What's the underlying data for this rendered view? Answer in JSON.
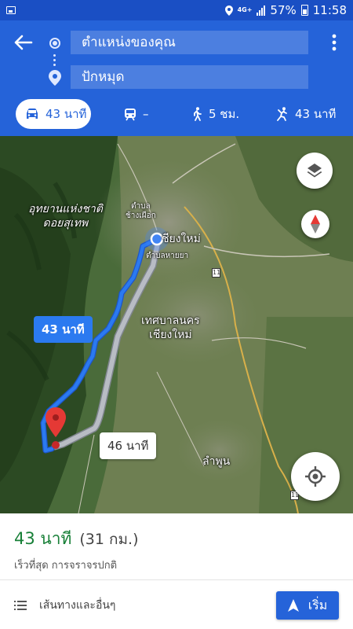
{
  "status_bar": {
    "network": "4G+",
    "battery": "57%",
    "time": "11:58"
  },
  "header": {
    "origin_text": "ตำแหน่งของคุณ",
    "destination_text": "ปักหมุด"
  },
  "modes": [
    {
      "mode": "drive",
      "icon": "car-icon",
      "label": "43 นาที",
      "selected": true
    },
    {
      "mode": "transit",
      "icon": "train-icon",
      "label": "–",
      "selected": false
    },
    {
      "mode": "walk",
      "icon": "walk-icon",
      "label": "5 ชม.",
      "selected": false
    },
    {
      "mode": "ride",
      "icon": "ride-icon",
      "label": "43 นาที",
      "selected": false
    }
  ],
  "map": {
    "labels": {
      "park": "อุทยานแห่งชาติ\nดอยสุเทพ",
      "chang_phueak": "ตำบล\nช้างเผือก",
      "chiang_mai": "ชียงใหม่",
      "hai_ya": "ตำบลหายยา",
      "municipality": "เทศบาลนคร\nเชียงใหม่",
      "lamphun": "ลำพูน",
      "shield": "11"
    },
    "route_primary_label": "43 นาที",
    "route_alternate_label": "46 นาที",
    "colors": {
      "primary_route": "#2b7af0",
      "alternate_route": "#b8bcc4",
      "pin": "#e53935"
    }
  },
  "summary": {
    "duration": "43 นาที",
    "distance": "(31 กม.)",
    "description": "เร็วที่สุด การจราจรปกติ"
  },
  "actions": {
    "steps_label": "เส้นทางและอื่นๆ",
    "start_label": "เริ่ม"
  }
}
